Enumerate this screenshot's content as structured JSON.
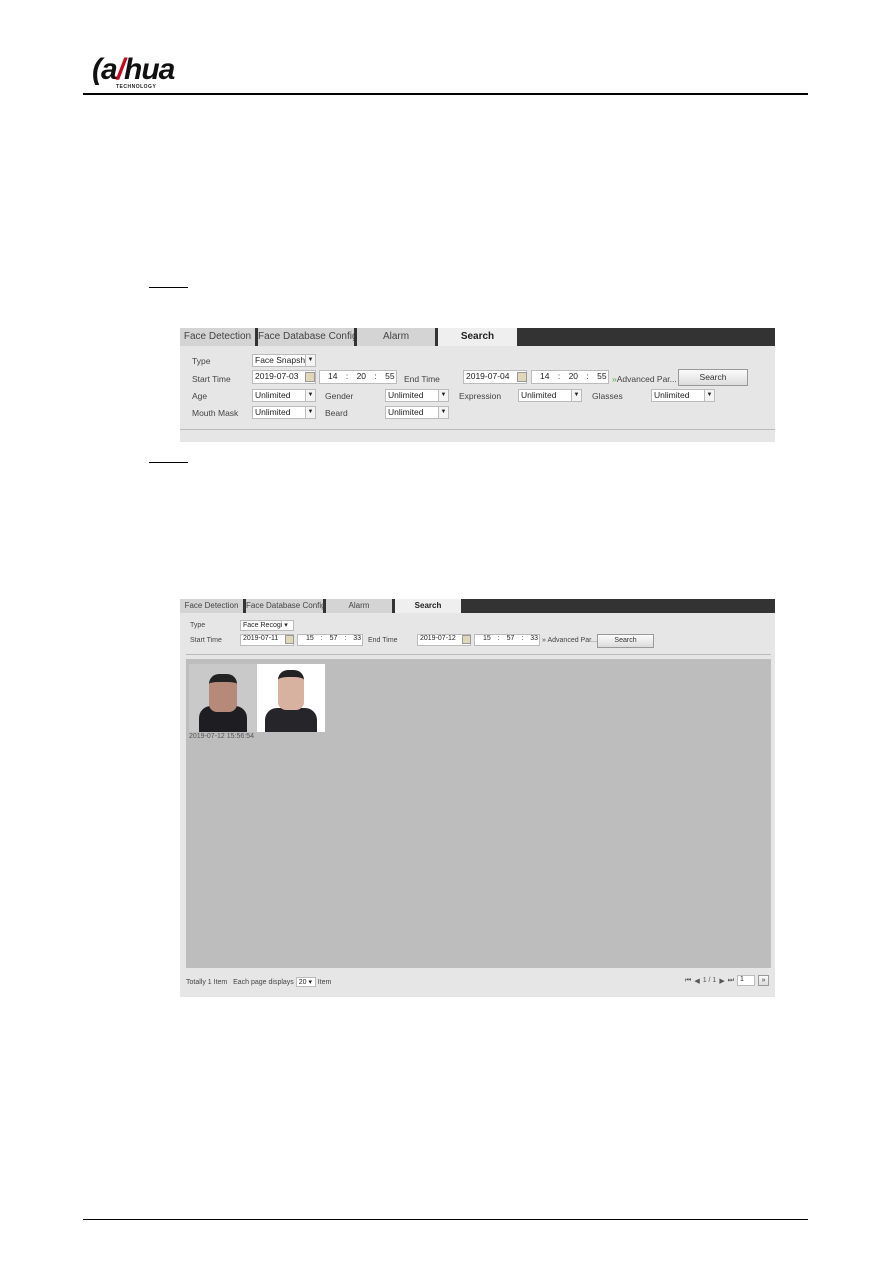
{
  "header": {
    "logo_text": "alhua",
    "logo_sub": "TECHNOLOGY"
  },
  "shot1": {
    "tabs": [
      "Face Detection",
      "Face Database Config",
      "Alarm",
      "Search"
    ],
    "type_label": "Type",
    "type_value": "Face Snapsh",
    "start_label": "Start Time",
    "start_date": "2019-07-03",
    "start_h": "14",
    "start_m": "20",
    "start_s": "55",
    "end_label": "End Time",
    "end_date": "2019-07-04",
    "end_h": "14",
    "end_m": "20",
    "end_s": "55",
    "advanced": "Advanced Par...",
    "search": "Search",
    "filters": [
      {
        "label": "Age",
        "value": "Unlimited"
      },
      {
        "label": "Gender",
        "value": "Unlimited"
      },
      {
        "label": "Expression",
        "value": "Unlimited"
      },
      {
        "label": "Glasses",
        "value": "Unlimited"
      },
      {
        "label": "Mouth Mask",
        "value": "Unlimited"
      },
      {
        "label": "Beard",
        "value": "Unlimited"
      }
    ]
  },
  "shot2": {
    "tabs": [
      "Face Detection",
      "Face Database Config",
      "Alarm",
      "Search"
    ],
    "type_label": "Type",
    "type_value": "Face Recogi",
    "start_label": "Start Time",
    "start_date": "2019-07-11",
    "start_h": "15",
    "start_m": "57",
    "start_s": "33",
    "end_label": "End Time",
    "end_date": "2019-07-12",
    "end_h": "15",
    "end_m": "57",
    "end_s": "33",
    "advanced": "Advanced Par...",
    "search": "Search",
    "result_time": "2019-07-12 15:56:54",
    "footer": {
      "total": "Totally 1 Item",
      "each": "Each page displays",
      "per_page": "20",
      "item": "Item",
      "page": "1 / 1",
      "goto": "1"
    }
  },
  "colors": {
    "tabbar": "#333333",
    "panel": "#e6e6e6",
    "results": "#bdbdbd",
    "logo_accent": "#d0021b"
  }
}
